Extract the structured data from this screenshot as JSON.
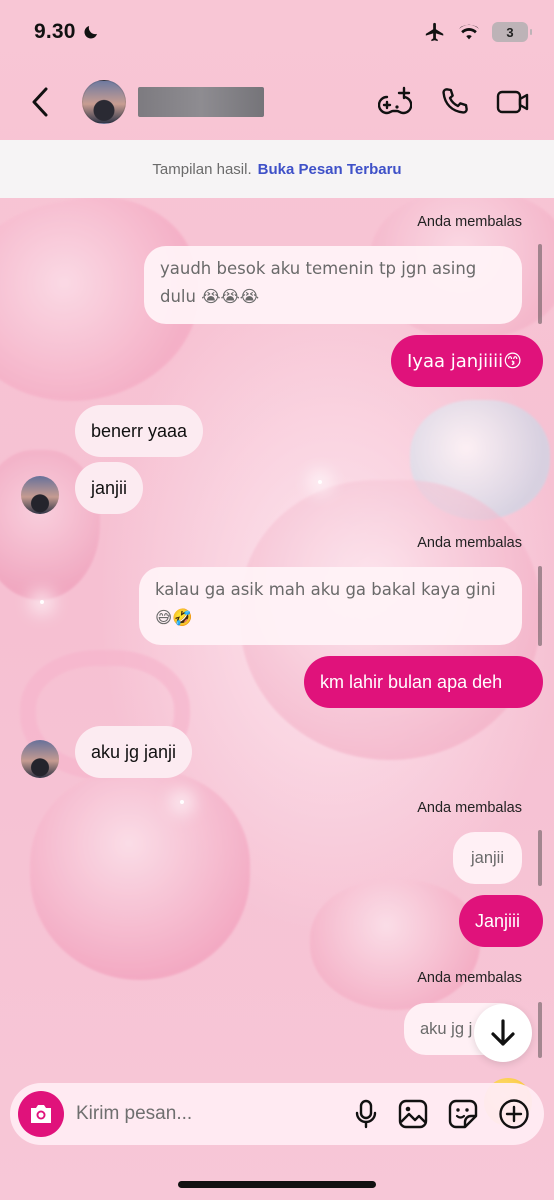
{
  "status_bar": {
    "time": "9.30",
    "battery": "3"
  },
  "header": {
    "back_icon": "chevron-left-icon",
    "contact_name": "",
    "actions": [
      "games-icon",
      "phone-icon",
      "video-icon"
    ]
  },
  "banner": {
    "text": "Tampilan hasil.",
    "link": "Buka Pesan Terbaru"
  },
  "messages": {
    "replied_label": "Anda membalas",
    "q1": "yaudh besok aku temenin tp jgn asing dulu 😭😭😭",
    "o1": "Iyaa janjiiii😙",
    "i1": "benerr yaaa",
    "i2": "janjii",
    "q2": "kalau ga asik mah aku ga bakal kaya gini😅🤣",
    "o2": "km lahir bulan apa deh",
    "i3": "aku jg janji",
    "q3": "janjii",
    "o3": "Janjiii",
    "q4": "aku jg j"
  },
  "composer": {
    "placeholder": "Kirim pesan...",
    "icons": [
      "camera-icon",
      "microphone-icon",
      "image-icon",
      "sticker-icon",
      "plus-circle-icon"
    ]
  },
  "colors": {
    "accent": "#e0127b",
    "link": "#3f51c8",
    "background": "#f8c9d8"
  }
}
